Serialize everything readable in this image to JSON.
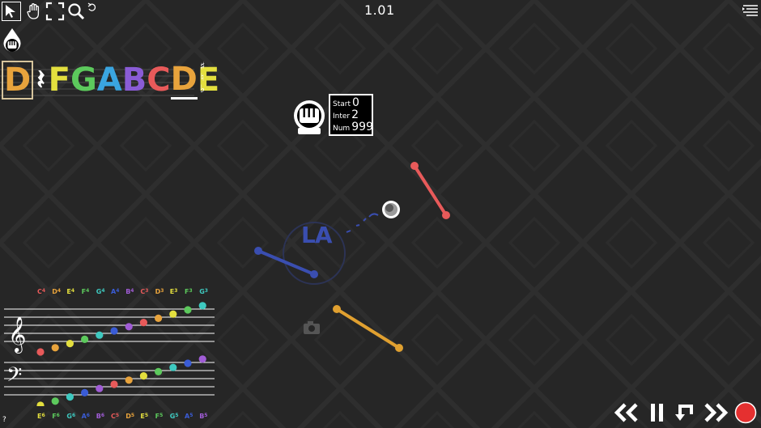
{
  "counter": "1.01",
  "colors": {
    "background": "#262626",
    "red": "#e85a5a",
    "blue": "#3a4eb0",
    "orange": "#e0a030",
    "record": "#e53030",
    "selection": "#d6c49c"
  },
  "toolbar": {
    "tools": [
      {
        "name": "select-arrow-icon"
      },
      {
        "name": "hand-pan-icon"
      },
      {
        "name": "fullscreen-icon"
      },
      {
        "name": "zoom-icon"
      },
      {
        "name": "undo-icon"
      }
    ],
    "menu_icon": "menu-list-icon"
  },
  "instrument": {
    "icon": "piano-drop-icon",
    "inner": "piano-icon"
  },
  "note_selector": {
    "notes": [
      {
        "text": "D",
        "color": "#e8a33c",
        "selected": true,
        "underline": false
      },
      {
        "text": "F",
        "color": "#e3df3e",
        "selected": false,
        "underline": false
      },
      {
        "text": "G",
        "color": "#5cc95c",
        "selected": false,
        "underline": false
      },
      {
        "text": "A",
        "color": "#3aa5e0",
        "selected": false,
        "underline": false
      },
      {
        "text": "B",
        "color": "#8a5cd6",
        "selected": false,
        "underline": false
      },
      {
        "text": "C",
        "color": "#e85a5a",
        "selected": false,
        "underline": false
      },
      {
        "text": "D",
        "color": "#e8a33c",
        "selected": false,
        "underline": true
      },
      {
        "text": "E",
        "color": "#e3df3e",
        "selected": false,
        "underline": false
      }
    ],
    "rest_symbol": "𝄽",
    "accidentals": [
      "♯",
      "♮",
      "♭"
    ]
  },
  "emitter": {
    "icon": "piano-emitter-icon",
    "start_label": "Start",
    "start_value": "0",
    "inter_label": "Inter",
    "inter_value": "2",
    "num_label": "Num",
    "num_value": "999"
  },
  "note_label": "LA",
  "staff": {
    "top_labels": [
      {
        "n": "C",
        "o": "4",
        "c": "#e85a5a"
      },
      {
        "n": "D",
        "o": "4",
        "c": "#e8a33c"
      },
      {
        "n": "E",
        "o": "4",
        "c": "#e3df3e"
      },
      {
        "n": "F",
        "o": "4",
        "c": "#5cc95c"
      },
      {
        "n": "G",
        "o": "4",
        "c": "#3ec9c0"
      },
      {
        "n": "A",
        "o": "4",
        "c": "#3a5cd6"
      },
      {
        "n": "B",
        "o": "4",
        "c": "#a05cd6"
      },
      {
        "n": "C",
        "o": "3",
        "c": "#e85a5a"
      },
      {
        "n": "D",
        "o": "3",
        "c": "#e8a33c"
      },
      {
        "n": "E",
        "o": "3",
        "c": "#e3df3e"
      },
      {
        "n": "F",
        "o": "3",
        "c": "#5cc95c"
      },
      {
        "n": "G",
        "o": "3",
        "c": "#3ec9c0"
      }
    ],
    "bottom_labels": [
      {
        "n": "E",
        "o": "6",
        "c": "#e3df3e"
      },
      {
        "n": "F",
        "o": "6",
        "c": "#5cc95c"
      },
      {
        "n": "G",
        "o": "6",
        "c": "#3ec9c0"
      },
      {
        "n": "A",
        "o": "6",
        "c": "#3a5cd6"
      },
      {
        "n": "B",
        "o": "6",
        "c": "#a05cd6"
      },
      {
        "n": "C",
        "o": "5",
        "c": "#e85a5a"
      },
      {
        "n": "D",
        "o": "5",
        "c": "#e8a33c"
      },
      {
        "n": "E",
        "o": "5",
        "c": "#e3df3e"
      },
      {
        "n": "F",
        "o": "5",
        "c": "#5cc95c"
      },
      {
        "n": "G",
        "o": "5",
        "c": "#3ec9c0"
      },
      {
        "n": "A",
        "o": "5",
        "c": "#3a5cd6"
      },
      {
        "n": "B",
        "o": "5",
        "c": "#a05cd6"
      }
    ],
    "treble_dot_colors": [
      "#e85a5a",
      "#e8a33c",
      "#e3df3e",
      "#5cc95c",
      "#3ec9c0",
      "#3a5cd6",
      "#a05cd6",
      "#e85a5a",
      "#e8a33c",
      "#e3df3e",
      "#5cc95c",
      "#3ec9c0"
    ],
    "bass_dot_colors": [
      "#e3df3e",
      "#5cc95c",
      "#3ec9c0",
      "#3a5cd6",
      "#a05cd6",
      "#e85a5a",
      "#e8a33c",
      "#e3df3e",
      "#5cc95c",
      "#3ec9c0",
      "#3a5cd6",
      "#a05cd6"
    ]
  },
  "help_label": "?",
  "controls": [
    {
      "name": "rewind-icon"
    },
    {
      "name": "pause-icon"
    },
    {
      "name": "loop-icon"
    },
    {
      "name": "fast-forward-icon"
    },
    {
      "name": "record-icon"
    }
  ]
}
